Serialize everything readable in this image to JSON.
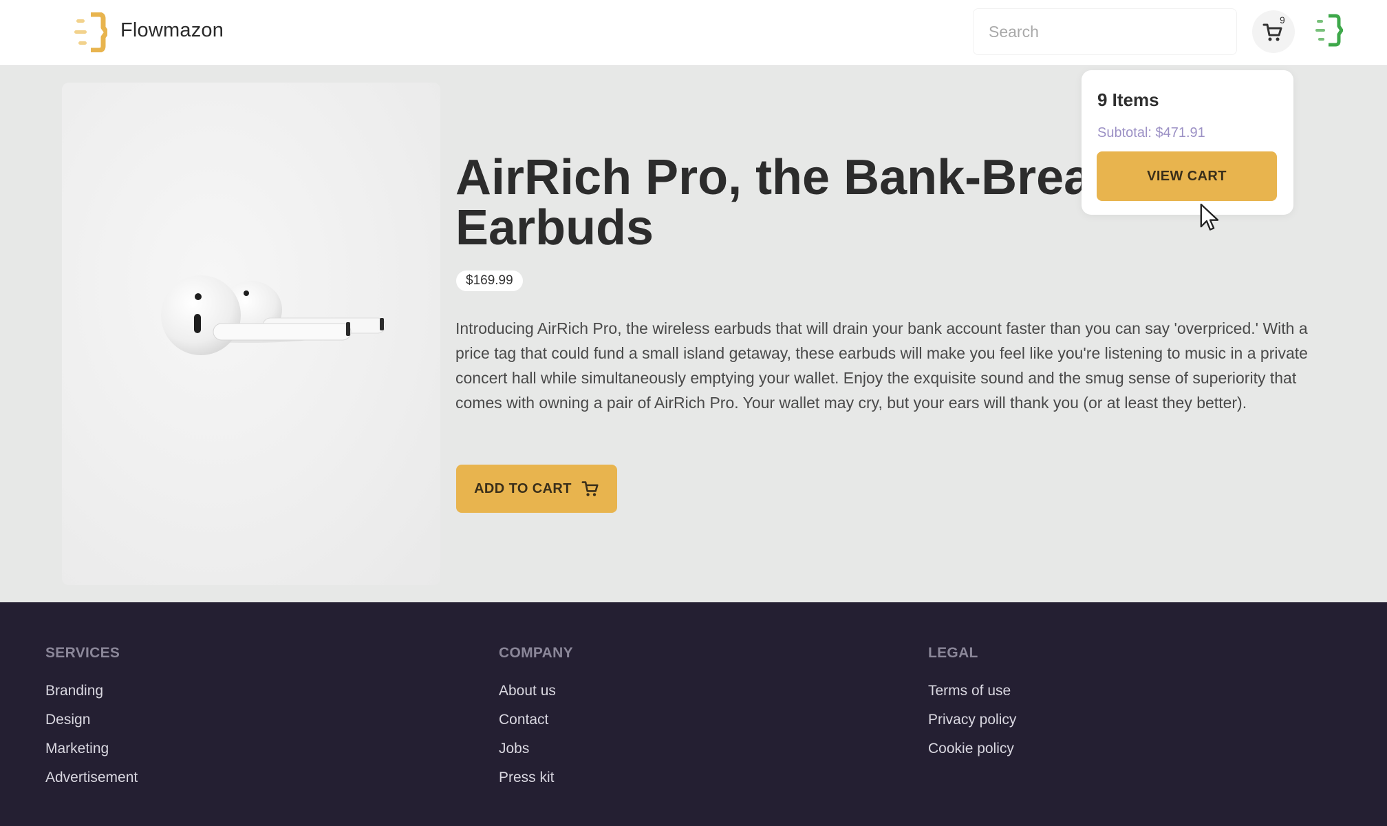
{
  "header": {
    "brand": "Flowmazon",
    "search_placeholder": "Search",
    "cart_count": "9"
  },
  "product": {
    "title": "AirRich Pro, the Bank-Breaking Earbuds",
    "title_visible_line1": "AirRich Pro, the Bank-Brea",
    "title_visible_line2": "Earbuds",
    "price": "$169.99",
    "description": "Introducing AirRich Pro, the wireless earbuds that will drain your bank account faster than you can say 'overpriced.' With a price tag that could fund a small island getaway, these earbuds will make you feel like you're listening to music in a private concert hall while simultaneously emptying your wallet. Enjoy the exquisite sound and the smug sense of superiority that comes with owning a pair of AirRich Pro. Your wallet may cry, but your ears will thank you (or at least they better).",
    "add_to_cart_label": "ADD TO CART"
  },
  "cart_popup": {
    "items": "9 Items",
    "subtotal": "Subtotal: $471.91",
    "view_cart_label": "VIEW CART"
  },
  "footer": {
    "columns": [
      {
        "heading": "SERVICES",
        "links": [
          "Branding",
          "Design",
          "Marketing",
          "Advertisement"
        ]
      },
      {
        "heading": "COMPANY",
        "links": [
          "About us",
          "Contact",
          "Jobs",
          "Press kit"
        ]
      },
      {
        "heading": "LEGAL",
        "links": [
          "Terms of use",
          "Privacy policy",
          "Cookie policy"
        ]
      }
    ]
  },
  "colors": {
    "accent": "#e8b44e",
    "footer_bg": "#241f32",
    "page_bg": "#e7e8e7",
    "subtotal_text": "#9c91c5"
  },
  "icons": [
    "logo-icon",
    "cart-icon",
    "menu-logo-icon",
    "product-image",
    "mouse-cursor-icon"
  ]
}
